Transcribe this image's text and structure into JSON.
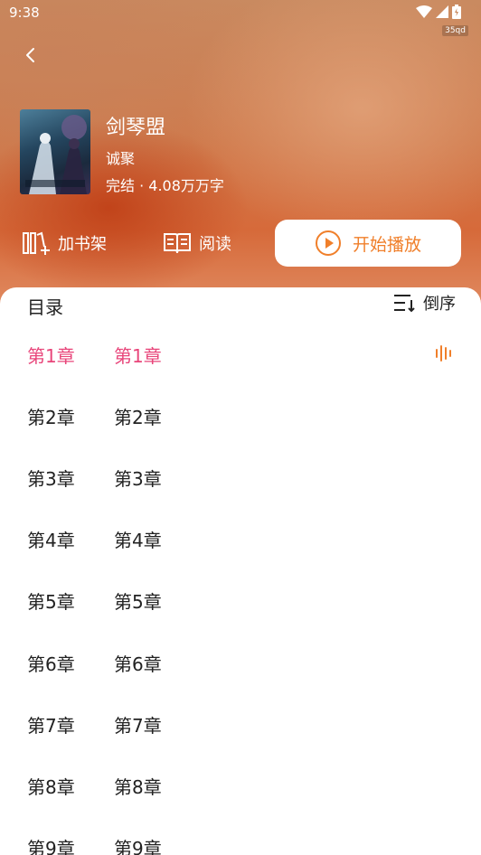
{
  "status_bar": {
    "time": "9:38",
    "carrier_badge": "35qd"
  },
  "book": {
    "title": "剑琴盟",
    "author": "诚聚",
    "meta": "完结 · 4.08万万字"
  },
  "actions": {
    "add_shelf": "加书架",
    "read": "阅读",
    "start_play": "开始播放"
  },
  "toc": {
    "title": "目录",
    "sort_label": "倒序",
    "chapters": [
      {
        "num": "第1章",
        "name": "第1章"
      },
      {
        "num": "第2章",
        "name": "第2章"
      },
      {
        "num": "第3章",
        "name": "第3章"
      },
      {
        "num": "第4章",
        "name": "第4章"
      },
      {
        "num": "第5章",
        "name": "第5章"
      },
      {
        "num": "第6章",
        "name": "第6章"
      },
      {
        "num": "第7章",
        "name": "第7章"
      },
      {
        "num": "第8章",
        "name": "第8章"
      },
      {
        "num": "第9章",
        "name": "第9章"
      }
    ]
  },
  "colors": {
    "active_chapter": "#e8457a",
    "accent_orange": "#f07f2a"
  }
}
